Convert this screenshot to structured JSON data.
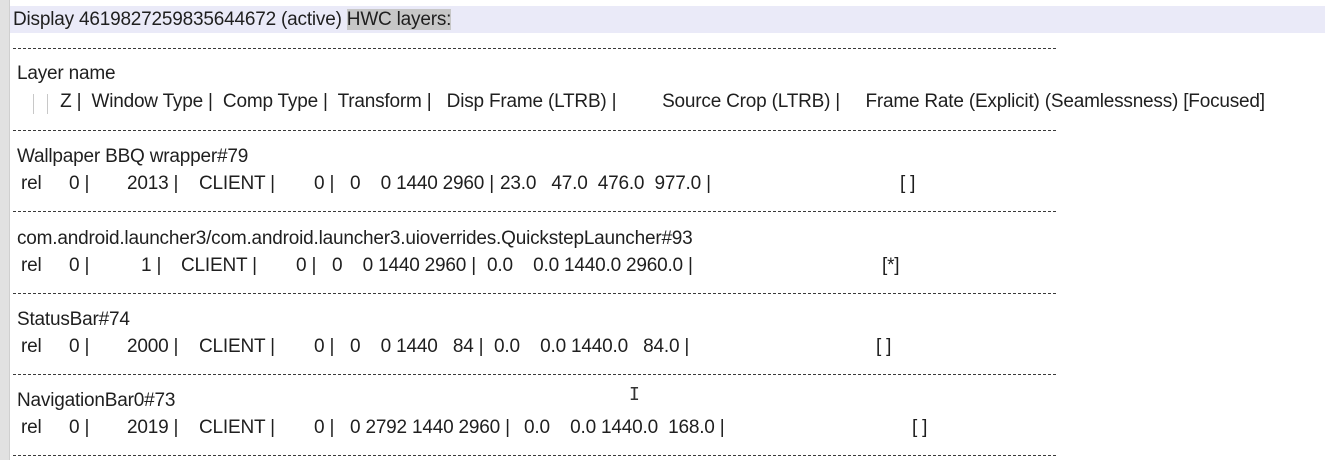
{
  "header": {
    "prefix": "Display 4619827259835644672 (active) ",
    "highlighted": "HWC layers:"
  },
  "columns": {
    "line1": "Layer name",
    "line2": " Z |  Window Type |  Comp Type |  Transform |   Disp Frame (LTRB) |         Source Crop (LTRB) |     Frame Rate (Explicit) (Seamlessness) [Focused]"
  },
  "layers": [
    {
      "name": "Wallpaper BBQ wrapper#79",
      "rel": "rel",
      "z": "0 |",
      "window_type": "2013 |",
      "comp_type": "CLIENT |",
      "transform": "0 |",
      "disp_frame": "0    0 1440 2960 |",
      "source_crop": "23.0   47.0  476.0  977.0 |",
      "focused": "[ ]"
    },
    {
      "name": "com.android.launcher3/com.android.launcher3.uioverrides.QuickstepLauncher#93",
      "rel": "rel",
      "z": "0 |",
      "window_type": "1 |",
      "comp_type": "CLIENT |",
      "transform": "0 |",
      "disp_frame": "0    0 1440 2960 |",
      "source_crop": "0.0    0.0 1440.0 2960.0 |",
      "focused": "[*]"
    },
    {
      "name": "StatusBar#74",
      "rel": "rel",
      "z": "0 |",
      "window_type": "2000 |",
      "comp_type": "CLIENT |",
      "transform": "0 |",
      "disp_frame": "0    0 1440   84 |",
      "source_crop": "0.0    0.0 1440.0   84.0 |",
      "focused": "[ ]"
    },
    {
      "name": "NavigationBar0#73",
      "rel": "rel",
      "z": "0 |",
      "window_type": "2019 |",
      "comp_type": "CLIENT |",
      "transform": "0 |",
      "disp_frame": "0 2792 1440 2960 |",
      "source_crop": "0.0    0.0 1440.0  168.0 |",
      "focused": "[ ]"
    }
  ],
  "cursor": "I"
}
